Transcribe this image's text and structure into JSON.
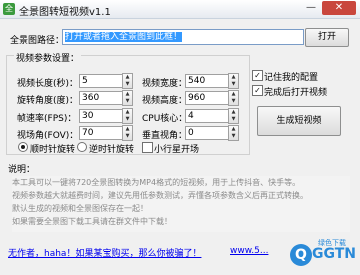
{
  "window": {
    "title": "全景图转短视频v1.1",
    "minimize_glyph": "—",
    "close_glyph": "✕",
    "icon_glyph": "全"
  },
  "path": {
    "label": "全景图路径：",
    "value": "打开或者拖入全景图到此框！",
    "open_label": "打开"
  },
  "params": {
    "group_title": "视频参数设置：",
    "length_label": "视频长度(秒)：",
    "length_value": "5",
    "angle_label": "旋转角度(度)：",
    "angle_value": "360",
    "fps_label": "帧速率(FPS)：",
    "fps_value": "30",
    "fov_label": "视场角(FOV)：",
    "fov_value": "70",
    "width_label": "视频宽度：",
    "width_value": "540",
    "height_label": "视频高度：",
    "height_value": "960",
    "cpu_label": "CPU核心：",
    "cpu_value": "4",
    "vangle_label": "垂直视角：",
    "vangle_value": "0",
    "cw_label": "顺时针旋转",
    "ccw_label": "逆时针旋转",
    "planet_label": "小行星开场"
  },
  "options": {
    "remember_label": "记住我的配置",
    "open_after_label": "完成后打开视频"
  },
  "generate_label": "生成短视频",
  "notes": {
    "title": "说明：",
    "lines": [
      "本工具可以一键将720全景图转换为MP4格式的短视频，用于上传抖音、快手等。",
      "视频参数越大就越费时间，建议先用低参数测试，弄懂各项参数含义后再正式转换。",
      "默认生成的视频和全景图保存在一起！",
      "如果需要全景图下载工具请在群文件中下载！"
    ]
  },
  "footer": {
    "link1": "无作者，haha！如果某宝购买，那么你被骗了！",
    "link2": "www.5...",
    "logo_glyph": "Q",
    "logo_text": "GGTN",
    "logo_caption": "绿色下载"
  }
}
